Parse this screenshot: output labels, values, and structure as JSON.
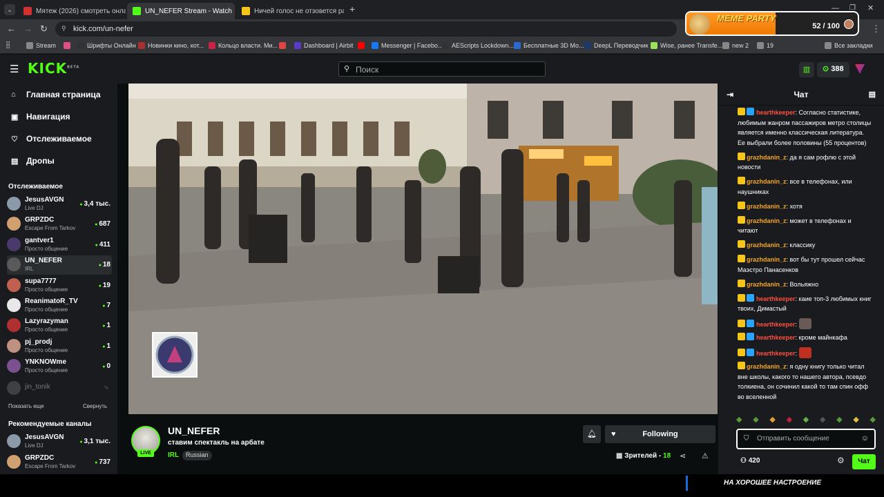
{
  "browser": {
    "tabs": [
      {
        "title": "Мятеж (2026) смотреть онлайн",
        "favicon_color": "#d03030"
      },
      {
        "title": "UN_NEFER Stream - Watch",
        "favicon_color": "#53fc18"
      },
      {
        "title": "Ничей голос не отзовется ра",
        "favicon_color": "#f5c518"
      }
    ],
    "url": "kick.com/un-nefer",
    "bookmarks": [
      {
        "label": "Stream",
        "color": "#888"
      },
      {
        "label": "",
        "color": "#e05080"
      },
      {
        "label": "Шрифты Онлайн",
        "color": "#333"
      },
      {
        "label": "Новинки кино, кот...",
        "color": "#aa3030"
      },
      {
        "label": "Кольцо власти. Ми...",
        "color": "#cc2244"
      },
      {
        "label": "",
        "color": "#d44"
      },
      {
        "label": "Dashboard | Airbit",
        "color": "#5a3cc8"
      },
      {
        "label": "",
        "color": "#f00"
      },
      {
        "label": "Messenger | Facebo...",
        "color": "#1877f2"
      },
      {
        "label": "AEScripts Lockdown...",
        "color": "#333"
      },
      {
        "label": "Бесплатные 3D Мо...",
        "color": "#2a6ad0"
      },
      {
        "label": "DeepL Переводчик",
        "color": "#1a3a6a"
      },
      {
        "label": "Wise, ранее Transfe...",
        "color": "#9ae35a"
      },
      {
        "label": "new 2",
        "color": "#888"
      },
      {
        "label": "19",
        "color": "#888"
      },
      {
        "label": "Все закладки",
        "color": "#888"
      }
    ]
  },
  "meme_party": {
    "title": "MEME PARTY",
    "count": "52 / 100",
    "progress": 0.52
  },
  "header": {
    "logo": "KICK",
    "logo_sup": "BETA",
    "search_placeholder": "Поиск",
    "kicks": "388"
  },
  "sidebar": {
    "nav": [
      {
        "label": "Главная страница",
        "icon": "home-icon",
        "glyph": "⌂"
      },
      {
        "label": "Навигация",
        "icon": "compass-icon",
        "glyph": "▣"
      },
      {
        "label": "Отслеживаемое",
        "icon": "heart-icon",
        "glyph": "♡"
      },
      {
        "label": "Дропы",
        "icon": "gift-icon",
        "glyph": "▤"
      }
    ],
    "following_title": "Отслеживаемое",
    "following": [
      {
        "name": "JesusAVGN",
        "category": "Live DJ",
        "viewers": "3,4 тыс.",
        "avatar": "#8a9aa8"
      },
      {
        "name": "GRPZDC",
        "category": "Escape From Tarkov",
        "viewers": "687",
        "avatar": "#d0a070"
      },
      {
        "name": "gantver1",
        "category": "Просто общение",
        "viewers": "411",
        "avatar": "#4a3a6a"
      },
      {
        "name": "UN_NEFER",
        "category": "IRL",
        "viewers": "18",
        "avatar": "#5a5a5a"
      },
      {
        "name": "supa7777",
        "category": "Просто общение",
        "viewers": "19",
        "avatar": "#c06050"
      },
      {
        "name": "ReanimatoR_TV",
        "category": "Просто общение",
        "viewers": "7",
        "avatar": "#e8e8e8"
      },
      {
        "name": "Lazyrazyman",
        "category": "Просто общение",
        "viewers": "1",
        "avatar": "#b03030"
      },
      {
        "name": "pj_prodj",
        "category": "Просто общение",
        "viewers": "1",
        "avatar": "#c09080"
      },
      {
        "name": "YNKNOWme",
        "category": "Просто общение",
        "viewers": "0",
        "avatar": "#7a5090"
      }
    ],
    "offline": {
      "name": "jin_tonik",
      "avatar": "#666"
    },
    "show_more": "Показать еще",
    "collapse": "Свернуть",
    "recommended_title": "Рекомендуемые каналы",
    "recommended": [
      {
        "name": "JesusAVGN",
        "category": "Live DJ",
        "viewers": "3,1 тыс.",
        "avatar": "#8a9aa8"
      },
      {
        "name": "GRPZDC",
        "category": "Escape From Tarkov",
        "viewers": "737",
        "avatar": "#d0a070"
      }
    ]
  },
  "stream": {
    "channel": "UN_NEFER",
    "title": "ставим спектакль на арбате",
    "category": "IRL",
    "language": "Russian",
    "live_label": "LIVE",
    "following_label": "Following",
    "viewers_label": "Зрителей -",
    "viewers": "18"
  },
  "chat": {
    "title": "Чат",
    "messages": [
      {
        "user": "hearthkeeper",
        "color": "#ff5040",
        "badges": 2,
        "text": "Согласно статистике, любимым жанром пассажиров метро столицы является именно классическая литература. Ее выбрали более половины (55 процентов)",
        "lines": 4
      },
      {
        "user": "grazhdanin_z",
        "color": "#f5a623",
        "badges": 1,
        "text": "да я сам рофлю с этой новости",
        "lines": 2
      },
      {
        "user": "grazhdanin_z",
        "color": "#f5a623",
        "badges": 1,
        "text": "все в телефонах, или наушниках",
        "lines": 2
      },
      {
        "user": "grazhdanin_z",
        "color": "#f5a623",
        "badges": 1,
        "text": "хотя",
        "lines": 1
      },
      {
        "user": "grazhdanin_z",
        "color": "#f5a623",
        "badges": 1,
        "text": "может в телефонах и читают",
        "lines": 2
      },
      {
        "user": "grazhdanin_z",
        "color": "#f5a623",
        "badges": 1,
        "text": "классику",
        "lines": 1
      },
      {
        "user": "grazhdanin_z",
        "color": "#f5a623",
        "badges": 1,
        "text": "вот бы тут прошел сейчас Маэстро Панасенков",
        "lines": 2
      },
      {
        "user": "grazhdanin_z",
        "color": "#f5a623",
        "badges": 1,
        "text": "Вольяжно",
        "lines": 1
      },
      {
        "user": "hearthkeeper",
        "color": "#ff5040",
        "badges": 2,
        "text": "каие топ-3 любимых книг твоих, Димастый",
        "lines": 2
      },
      {
        "user": "hearthkeeper",
        "color": "#ff5040",
        "badges": 2,
        "text": "",
        "lines": 1
      },
      {
        "user": "hearthkeeper",
        "color": "#ff5040",
        "badges": 2,
        "text": "кроме майнкафа",
        "lines": 1
      },
      {
        "user": "hearthkeeper",
        "color": "#ff5040",
        "badges": 2,
        "text": "",
        "lines": 1
      },
      {
        "user": "grazhdanin_z",
        "color": "#f5a623",
        "badges": 1,
        "text": "я одну книгу только читал вне школы, какого то нашего автора, псевдо толкиена, он сочинил какой то там спин офф во вселенной",
        "lines": 4
      }
    ],
    "input_placeholder": "Отправить сообщение",
    "points": "420",
    "send_label": "Чат"
  },
  "banner": {
    "tagline": "НА ХОРОШЕЕ НАСТРОЕНИЕ"
  }
}
